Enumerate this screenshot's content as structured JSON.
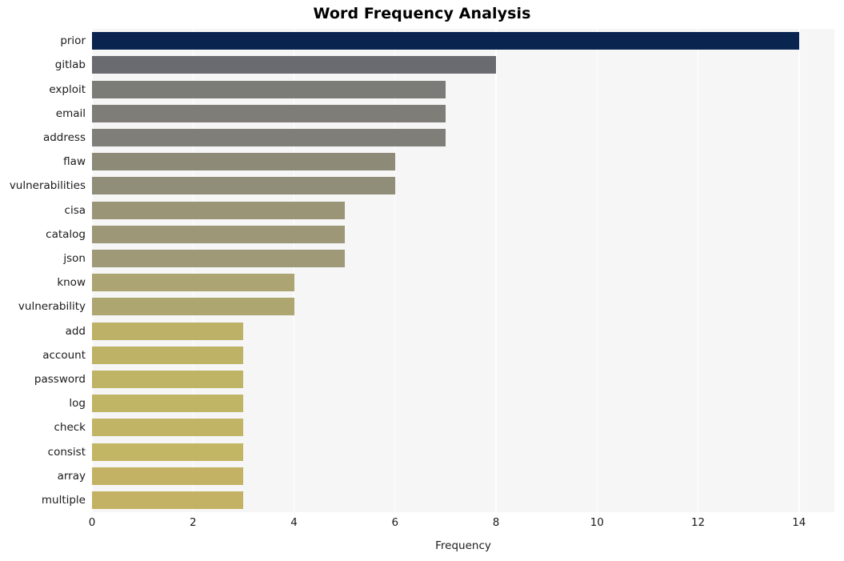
{
  "chart_data": {
    "type": "bar",
    "orientation": "horizontal",
    "title": "Word Frequency Analysis",
    "xlabel": "Frequency",
    "ylabel": "",
    "categories": [
      "prior",
      "gitlab",
      "exploit",
      "email",
      "address",
      "flaw",
      "vulnerabilities",
      "cisa",
      "catalog",
      "json",
      "know",
      "vulnerability",
      "add",
      "account",
      "password",
      "log",
      "check",
      "consist",
      "array",
      "multiple"
    ],
    "values": [
      14,
      8,
      7,
      7,
      7,
      6,
      6,
      5,
      5,
      5,
      4,
      4,
      3,
      3,
      3,
      3,
      3,
      3,
      3,
      3
    ],
    "bar_colors": [
      "#0a2450",
      "#6a6b70",
      "#7b7b78",
      "#7e7d78",
      "#7f7e78",
      "#8d8a77",
      "#908d78",
      "#9b9578",
      "#9d9778",
      "#9f9978",
      "#aca472",
      "#aea670",
      "#bcb167",
      "#bdb266",
      "#bfb365",
      "#c0b465",
      "#c1b565",
      "#c2b564",
      "#c3b264",
      "#c3b264"
    ],
    "xlim": [
      0,
      14.7
    ],
    "xticks": [
      0,
      2,
      4,
      6,
      8,
      10,
      12,
      14
    ],
    "xtick_labels": [
      "0",
      "2",
      "4",
      "6",
      "8",
      "10",
      "12",
      "14"
    ],
    "grid": true,
    "grid_axis": "x",
    "grid_color": "#ffffff",
    "plot_background": "#f6f6f6",
    "figure_background": "#ffffff",
    "legend": null
  }
}
